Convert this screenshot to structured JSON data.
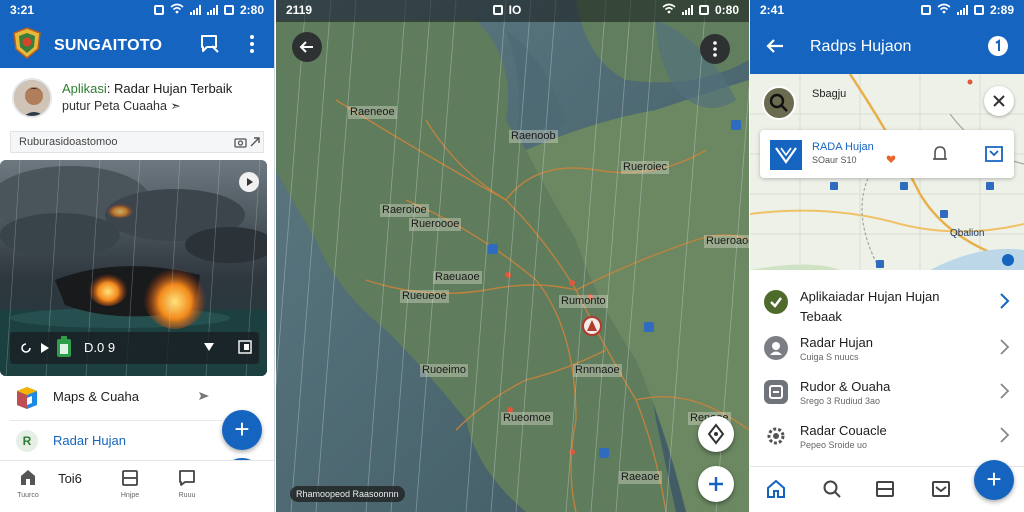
{
  "left": {
    "status": {
      "time": "3:21",
      "battery": "2:80"
    },
    "appbar": {
      "title": "SUNGAITOTO"
    },
    "profile": {
      "line1_green": "Aplikasi",
      "line1_rest": ": Radar Hujan Terbaik",
      "line2": "putur Peta Cuaaha ➣"
    },
    "search_row": {
      "text": "Ruburasidoastomoo"
    },
    "media_controls": {
      "time": "D.0 9"
    },
    "list": [
      {
        "label": "Maps & Cuaha"
      },
      {
        "label": "Radar Hujan"
      }
    ],
    "bottom_nav": [
      {
        "label": "Tuurco"
      },
      {
        "label": "Toi6"
      },
      {
        "label": "Hnjpe"
      },
      {
        "label": "Ruuu"
      }
    ]
  },
  "middle": {
    "status": {
      "time": "2119",
      "center": "IO",
      "right": "0:80"
    },
    "map_labels": [
      "Raeneoe",
      "Raenoob",
      "Rueroiec",
      "Raeroioe",
      "Rueroooe",
      "Rueroaoe",
      "Raeuaoe",
      "Rueueoe",
      "Rumonto",
      "Ruoeimo",
      "Rnnnaoe",
      "Renooe",
      "Rueomoe",
      "Raeaoe"
    ],
    "credit": "Rhamoopeod Raasoonnn"
  },
  "right": {
    "status": {
      "time": "2:41",
      "battery": "2:89"
    },
    "appbar": {
      "title": "Radps Hujaon"
    },
    "map": {
      "place": "Sbagju",
      "place2": "Qbalion"
    },
    "card": {
      "title": "RADA Hujan",
      "subtitle": "SOaur S10"
    },
    "list": [
      {
        "title": "Aplikaiadar Hujan Hujan",
        "title2": "Tebaak",
        "sub": ""
      },
      {
        "title": "Radar Hujan",
        "sub": "Cuiga S nuucs"
      },
      {
        "title": "Rudor & Ouaha",
        "sub": "Srego 3 Rudiud 3ao"
      },
      {
        "title": "Radar Couacle",
        "sub": "Pepeo Sroide uo"
      }
    ]
  },
  "colors": {
    "brand": "#1565c0",
    "map_green": "#4d6a5e",
    "road": "#d2873c"
  }
}
